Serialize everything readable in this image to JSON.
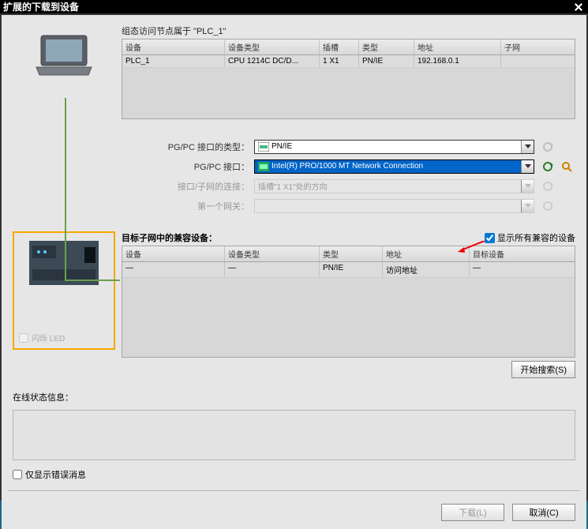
{
  "window": {
    "title": "扩展的下载到设备"
  },
  "top": {
    "caption": "组态访问节点属于 \"PLC_1\"",
    "headers": [
      "设备",
      "设备类型",
      "插槽",
      "类型",
      "地址",
      "子网"
    ],
    "row": [
      "PLC_1",
      "CPU 1214C DC/D...",
      "1 X1",
      "PN/IE",
      "192.168.0.1",
      ""
    ]
  },
  "form": {
    "pgpc_type_lbl": "PG/PC 接口的类型：",
    "pgpc_type_val": "PN/IE",
    "pgpc_iface_lbl": "PG/PC 接口：",
    "pgpc_iface_val": "Intel(R) PRO/1000 MT Network Connection",
    "subnet_lbl": "接口/子网的连接：",
    "subnet_ph": "插槽\"1 X1\"处的方向",
    "gateway_lbl": "第一个网关：",
    "gateway_ph": ""
  },
  "lower": {
    "compat_lbl": "目标子网中的兼容设备：",
    "show_all_lbl": "显示所有兼容的设备",
    "headers": [
      "设备",
      "设备类型",
      "类型",
      "地址",
      "目标设备"
    ],
    "row": [
      "—",
      "—",
      "PN/IE",
      "访问地址",
      "—"
    ],
    "flash_led": "闪烁 LED",
    "search_btn": "开始搜索(S)"
  },
  "status": {
    "label": "在线状态信息：",
    "err_only": "仅显示错误消息"
  },
  "footer": {
    "download": "下载(L)",
    "cancel": "取消(C)"
  }
}
